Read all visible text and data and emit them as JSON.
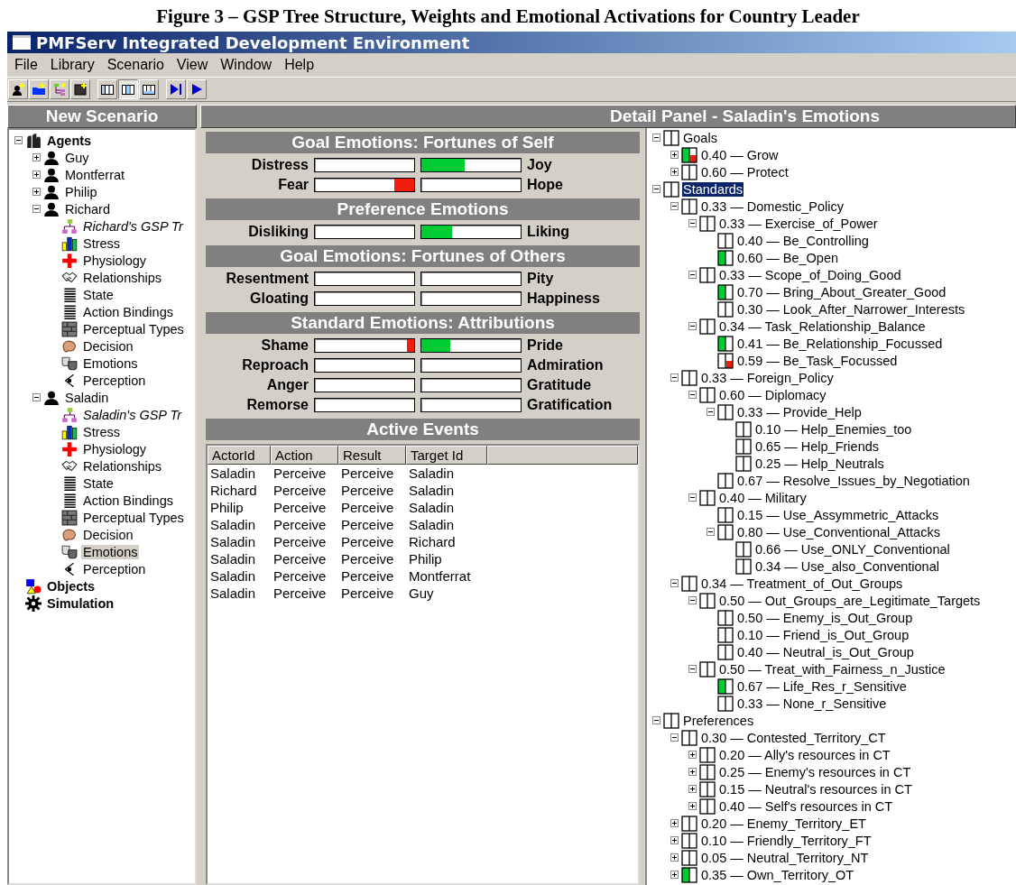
{
  "caption": "Figure 3 – GSP Tree Structure, Weights and Emotional Activations for Country Leader",
  "window": {
    "title": "PMFServ Integrated Development Environment"
  },
  "menu": [
    "File",
    "Library",
    "Scenario",
    "View",
    "Window",
    "Help"
  ],
  "toolbar": [
    {
      "kind": "add-agent",
      "selected": false
    },
    {
      "kind": "add-folder",
      "selected": false
    },
    {
      "kind": "add-tree",
      "selected": false
    },
    {
      "kind": "add-picture",
      "selected": false
    },
    {
      "kind": "layout-left",
      "selected": false
    },
    {
      "kind": "layout-middle",
      "selected": true
    },
    {
      "kind": "layout-bottom",
      "selected": false
    },
    {
      "kind": "step",
      "selected": false
    },
    {
      "kind": "play",
      "selected": false
    }
  ],
  "scenario": {
    "title": "New Scenario",
    "items": [
      {
        "label": "Agents",
        "kind": "agents",
        "expanded": true,
        "selected": false,
        "children": [
          {
            "label": "Guy",
            "kind": "person",
            "expanded": false,
            "selected": false
          },
          {
            "label": "Montferrat",
            "kind": "person",
            "expanded": false,
            "selected": false
          },
          {
            "label": "Philip",
            "kind": "person",
            "expanded": false,
            "selected": false
          },
          {
            "label": "Richard",
            "kind": "person",
            "expanded": true,
            "selected": false,
            "children": [
              {
                "label": "Richard's GSP Tr",
                "kind": "gsp",
                "selected": false
              },
              {
                "label": "Stress",
                "kind": "stress",
                "selected": false
              },
              {
                "label": "Physiology",
                "kind": "physiology",
                "selected": false
              },
              {
                "label": "Relationships",
                "kind": "relationships",
                "selected": false
              },
              {
                "label": "State",
                "kind": "list",
                "selected": false
              },
              {
                "label": "Action Bindings",
                "kind": "list",
                "selected": false
              },
              {
                "label": "Perceptual Types",
                "kind": "grid",
                "selected": false
              },
              {
                "label": "Decision",
                "kind": "decision",
                "selected": false
              },
              {
                "label": "Emotions",
                "kind": "emotions",
                "selected": false
              },
              {
                "label": "Perception",
                "kind": "perception",
                "selected": false
              }
            ]
          },
          {
            "label": "Saladin",
            "kind": "person",
            "expanded": true,
            "selected": false,
            "children": [
              {
                "label": "Saladin's GSP Tr",
                "kind": "gsp",
                "selected": false
              },
              {
                "label": "Stress",
                "kind": "stress",
                "selected": false
              },
              {
                "label": "Physiology",
                "kind": "physiology",
                "selected": false
              },
              {
                "label": "Relationships",
                "kind": "relationships",
                "selected": false
              },
              {
                "label": "State",
                "kind": "list",
                "selected": false
              },
              {
                "label": "Action Bindings",
                "kind": "list",
                "selected": false
              },
              {
                "label": "Perceptual Types",
                "kind": "grid",
                "selected": false
              },
              {
                "label": "Decision",
                "kind": "decision",
                "selected": false
              },
              {
                "label": "Emotions",
                "kind": "emotions",
                "selected": true
              },
              {
                "label": "Perception",
                "kind": "perception",
                "selected": false
              }
            ]
          }
        ]
      },
      {
        "label": "Objects",
        "kind": "objects",
        "selected": false
      },
      {
        "label": "Simulation",
        "kind": "simulation",
        "selected": false
      }
    ]
  },
  "detail": {
    "title": "Detail Panel - Saladin's Emotions",
    "sections": [
      {
        "title": "Goal Emotions: Fortunes of Self",
        "rows": [
          {
            "left": {
              "label": "Distress"
            },
            "right": {
              "label": "Joy",
              "level": 0.44
            }
          },
          {
            "left": {
              "label": "Fear",
              "level": 0.2
            },
            "right": {
              "label": "Hope"
            }
          }
        ]
      },
      {
        "title": "Preference Emotions",
        "rows": [
          {
            "left": {
              "label": "Disliking"
            },
            "right": {
              "label": "Liking",
              "level": 0.31
            }
          }
        ]
      },
      {
        "title": "Goal Emotions: Fortunes of Others",
        "rows": [
          {
            "left": {
              "label": "Resentment"
            },
            "right": {
              "label": "Pity"
            }
          },
          {
            "left": {
              "label": "Gloating"
            },
            "right": {
              "label": "Happiness"
            }
          }
        ]
      },
      {
        "title": "Standard Emotions: Attributions",
        "rows": [
          {
            "left": {
              "label": "Shame",
              "level": 0.07
            },
            "right": {
              "label": "Pride",
              "level": 0.29
            }
          },
          {
            "left": {
              "label": "Reproach"
            },
            "right": {
              "label": "Admiration"
            }
          },
          {
            "left": {
              "label": "Anger"
            },
            "right": {
              "label": "Gratitude"
            }
          },
          {
            "left": {
              "label": "Remorse"
            },
            "right": {
              "label": "Gratification"
            }
          }
        ]
      }
    ],
    "events": {
      "title": "Active Events",
      "columns": [
        "ActorId",
        "Action",
        "Result",
        "Target Id"
      ],
      "rows": [
        [
          "Saladin",
          "Perceive",
          "Perceive",
          "Saladin"
        ],
        [
          "Richard",
          "Perceive",
          "Perceive",
          "Saladin"
        ],
        [
          "Philip",
          "Perceive",
          "Perceive",
          "Saladin"
        ],
        [
          "Saladin",
          "Perceive",
          "Perceive",
          "Saladin"
        ],
        [
          "Saladin",
          "Perceive",
          "Perceive",
          "Richard"
        ],
        [
          "Saladin",
          "Perceive",
          "Perceive",
          "Philip"
        ],
        [
          "Saladin",
          "Perceive",
          "Perceive",
          "Montferrat"
        ],
        [
          "Saladin",
          "Perceive",
          "Perceive",
          "Guy"
        ]
      ]
    },
    "gsp": [
      {
        "label": "Goals",
        "positive": false,
        "negative": false,
        "expanded": true,
        "selected": false,
        "children": [
          {
            "label": "0.40 — Grow",
            "positive": true,
            "negative": true,
            "expanded": false,
            "selected": false
          },
          {
            "label": "0.60 — Protect",
            "positive": false,
            "negative": false,
            "expanded": false,
            "selected": false
          }
        ]
      },
      {
        "label": "Standards",
        "positive": false,
        "negative": false,
        "expanded": true,
        "selected": true,
        "children": [
          {
            "label": "0.33 — Domestic_Policy",
            "positive": false,
            "negative": false,
            "expanded": true,
            "selected": false,
            "children": [
              {
                "label": "0.33 — Exercise_of_Power",
                "positive": false,
                "negative": false,
                "expanded": true,
                "selected": false,
                "children": [
                  {
                    "label": "0.40 — Be_Controlling",
                    "positive": false,
                    "negative": false,
                    "selected": false
                  },
                  {
                    "label": "0.60 — Be_Open",
                    "positive": true,
                    "negative": false,
                    "selected": false
                  }
                ]
              },
              {
                "label": "0.33 — Scope_of_Doing_Good",
                "positive": false,
                "negative": false,
                "expanded": true,
                "selected": false,
                "children": [
                  {
                    "label": "0.70 — Bring_About_Greater_Good",
                    "positive": true,
                    "negative": false,
                    "selected": false
                  },
                  {
                    "label": "0.30 — Look_After_Narrower_Interests",
                    "positive": false,
                    "negative": false,
                    "selected": false
                  }
                ]
              },
              {
                "label": "0.34 — Task_Relationship_Balance",
                "positive": false,
                "negative": false,
                "expanded": true,
                "selected": false,
                "children": [
                  {
                    "label": "0.41 — Be_Relationship_Focussed",
                    "positive": true,
                    "negative": false,
                    "selected": false
                  },
                  {
                    "label": "0.59 — Be_Task_Focussed",
                    "positive": false,
                    "negative": true,
                    "selected": false
                  }
                ]
              }
            ]
          },
          {
            "label": "0.33 — Foreign_Policy",
            "positive": false,
            "negative": false,
            "expanded": true,
            "selected": false,
            "children": [
              {
                "label": "0.60 — Diplomacy",
                "positive": false,
                "negative": false,
                "expanded": true,
                "selected": false,
                "children": [
                  {
                    "label": "0.33 — Provide_Help",
                    "positive": false,
                    "negative": false,
                    "expanded": true,
                    "selected": false,
                    "children": [
                      {
                        "label": "0.10 — Help_Enemies_too",
                        "positive": false,
                        "negative": false,
                        "selected": false
                      },
                      {
                        "label": "0.65 — Help_Friends",
                        "positive": false,
                        "negative": false,
                        "selected": false
                      },
                      {
                        "label": "0.25 — Help_Neutrals",
                        "positive": false,
                        "negative": false,
                        "selected": false
                      }
                    ]
                  },
                  {
                    "label": "0.67 — Resolve_Issues_by_Negotiation",
                    "positive": false,
                    "negative": false,
                    "selected": false
                  }
                ]
              },
              {
                "label": "0.40 — Military",
                "positive": false,
                "negative": false,
                "expanded": true,
                "selected": false,
                "children": [
                  {
                    "label": "0.15 — Use_Assymmetric_Attacks",
                    "positive": false,
                    "negative": false,
                    "selected": false
                  },
                  {
                    "label": "0.80 — Use_Conventional_Attacks",
                    "positive": false,
                    "negative": false,
                    "expanded": true,
                    "selected": false,
                    "children": [
                      {
                        "label": "0.66 — Use_ONLY_Conventional",
                        "positive": false,
                        "negative": false,
                        "selected": false
                      },
                      {
                        "label": "0.34 — Use_also_Conventional",
                        "positive": false,
                        "negative": false,
                        "selected": false
                      }
                    ]
                  }
                ]
              }
            ]
          },
          {
            "label": "0.34 — Treatment_of_Out_Groups",
            "positive": false,
            "negative": false,
            "expanded": true,
            "selected": false,
            "children": [
              {
                "label": "0.50 — Out_Groups_are_Legitimate_Targets",
                "positive": false,
                "negative": false,
                "expanded": true,
                "selected": false,
                "children": [
                  {
                    "label": "0.50 — Enemy_is_Out_Group",
                    "positive": false,
                    "negative": false,
                    "selected": false
                  },
                  {
                    "label": "0.10 — Friend_is_Out_Group",
                    "positive": false,
                    "negative": false,
                    "selected": false
                  },
                  {
                    "label": "0.40 — Neutral_is_Out_Group",
                    "positive": false,
                    "negative": false,
                    "selected": false
                  }
                ]
              },
              {
                "label": "0.50 — Treat_with_Fairness_n_Justice",
                "positive": false,
                "negative": false,
                "expanded": true,
                "selected": false,
                "children": [
                  {
                    "label": "0.67 — Life_Res_r_Sensitive",
                    "positive": true,
                    "negative": false,
                    "selected": false
                  },
                  {
                    "label": "0.33 — None_r_Sensitive",
                    "positive": false,
                    "negative": false,
                    "selected": false
                  }
                ]
              }
            ]
          }
        ]
      },
      {
        "label": "Preferences",
        "positive": false,
        "negative": false,
        "expanded": true,
        "selected": false,
        "children": [
          {
            "label": "0.30 — Contested_Territory_CT",
            "positive": false,
            "negative": false,
            "expanded": true,
            "selected": false,
            "children": [
              {
                "label": "0.20 — Ally's resources in CT",
                "positive": false,
                "negative": false,
                "expanded": false,
                "selected": false
              },
              {
                "label": "0.25 — Enemy's resources in CT",
                "positive": false,
                "negative": false,
                "expanded": false,
                "selected": false
              },
              {
                "label": "0.15 — Neutral's resources in CT",
                "positive": false,
                "negative": false,
                "expanded": false,
                "selected": false
              },
              {
                "label": "0.40 — Self's resources in CT",
                "positive": false,
                "negative": false,
                "expanded": false,
                "selected": false
              }
            ]
          },
          {
            "label": "0.20 — Enemy_Territory_ET",
            "positive": false,
            "negative": false,
            "expanded": false,
            "selected": false
          },
          {
            "label": "0.10 — Friendly_Territory_FT",
            "positive": false,
            "negative": false,
            "expanded": false,
            "selected": false
          },
          {
            "label": "0.05 — Neutral_Territory_NT",
            "positive": false,
            "negative": false,
            "expanded": false,
            "selected": false
          },
          {
            "label": "0.35 — Own_Territory_OT",
            "positive": true,
            "negative": false,
            "expanded": false,
            "selected": false
          }
        ]
      }
    ]
  }
}
